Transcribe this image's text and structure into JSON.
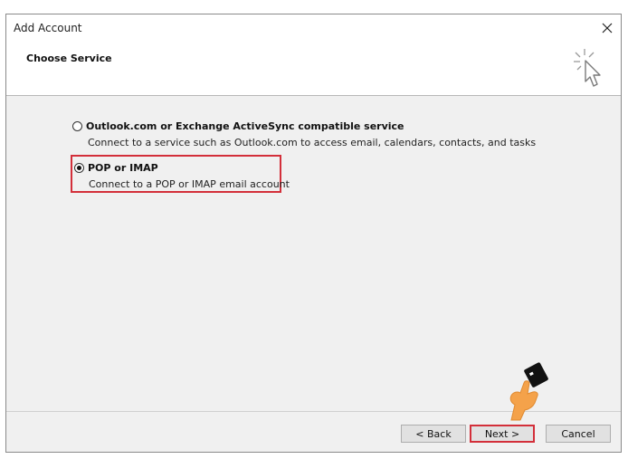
{
  "window": {
    "title": "Add Account",
    "close_glyph": "✕"
  },
  "header": {
    "title": "Choose Service",
    "icon": "wizard-cursor-icon"
  },
  "options": [
    {
      "label": "Outlook.com or Exchange ActiveSync compatible service",
      "description": "Connect to a service such as Outlook.com to access email, calendars, contacts, and tasks",
      "selected": false
    },
    {
      "label": "POP or IMAP",
      "description": "Connect to a POP or IMAP email account",
      "selected": true
    }
  ],
  "buttons": {
    "back": "< Back",
    "next": "Next >",
    "cancel": "Cancel"
  },
  "colors": {
    "highlight": "#d32f3a",
    "hand": "#f4a24a"
  },
  "annotation": {
    "icon": "pointing-hand-icon"
  }
}
